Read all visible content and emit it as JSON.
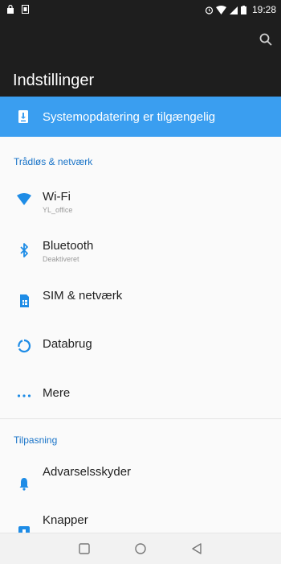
{
  "status_bar": {
    "time": "19:28"
  },
  "header": {
    "title": "Indstillinger"
  },
  "banner": {
    "label": "Systemopdatering er tilgængelig"
  },
  "sections": {
    "wireless": {
      "header": "Trådløs & netværk",
      "items": [
        {
          "label": "Wi-Fi",
          "subtitle": "YL_office"
        },
        {
          "label": "Bluetooth",
          "subtitle": "Deaktiveret"
        },
        {
          "label": "SIM & netværk"
        },
        {
          "label": "Databrug"
        },
        {
          "label": "Mere"
        }
      ]
    },
    "personal": {
      "header": "Tilpasning",
      "items": [
        {
          "label": "Advarselsskyder"
        },
        {
          "label": "Knapper"
        }
      ]
    }
  },
  "colors": {
    "accent": "#3a9ef0",
    "bar_bg": "#1e1e1e",
    "section_header": "#1a74c8"
  }
}
